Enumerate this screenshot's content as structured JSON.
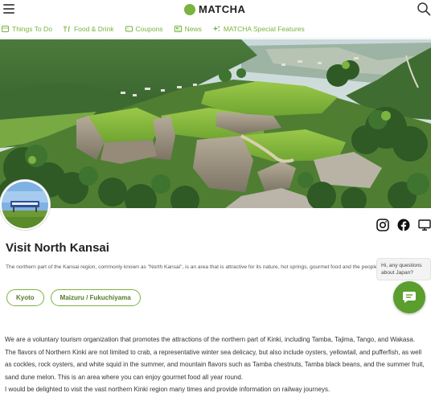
{
  "header": {
    "logo_text": "MATCHA",
    "brand_color": "#7ab33d"
  },
  "nav": {
    "items": [
      {
        "label": "Things To Do",
        "icon": "ticket-icon"
      },
      {
        "label": "Food & Drink",
        "icon": "utensils-icon"
      },
      {
        "label": "Coupons",
        "icon": "coupon-icon"
      },
      {
        "label": "News",
        "icon": "newspaper-icon"
      },
      {
        "label": "MATCHA Special Features",
        "icon": "sparkles-icon"
      }
    ]
  },
  "hero": {
    "image_subject": "hilltop castle ruins with stone walls and terraced green lawns"
  },
  "profile": {
    "title": "Visit North Kansai",
    "description": "The northern part of the Kansai region, commonly known as \"North Kansai\", is an area that is attractive for its nature, hot springs, gourmet food and the people.",
    "tags": [
      "Kyoto",
      "Maizuru / Fukuchiyama"
    ],
    "social": [
      "instagram-icon",
      "facebook-icon",
      "monitor-icon"
    ]
  },
  "chat": {
    "prompt": "Hi, any questions about Japan?"
  },
  "body": {
    "paragraphs": [
      "We are a voluntary tourism organization that promotes the attractions of the northern part of Kinki, including Tamba, Tajima, Tango, and Wakasa.",
      "The flavors of Northern Kinki are not limited to crab, a representative winter sea delicacy, but also include oysters, yellowtail, and pufferfish, as well as cockles, rock oysters, and white squid in the summer, and mountain flavors such as Tamba chestnuts, Tamba black beans, and the summer fruit, sand dune melon. This is an area where you can enjoy gourmet food all year round.",
      "I would be delighted to visit the vast northern Kinki region many times and provide information on railway journeys."
    ]
  }
}
